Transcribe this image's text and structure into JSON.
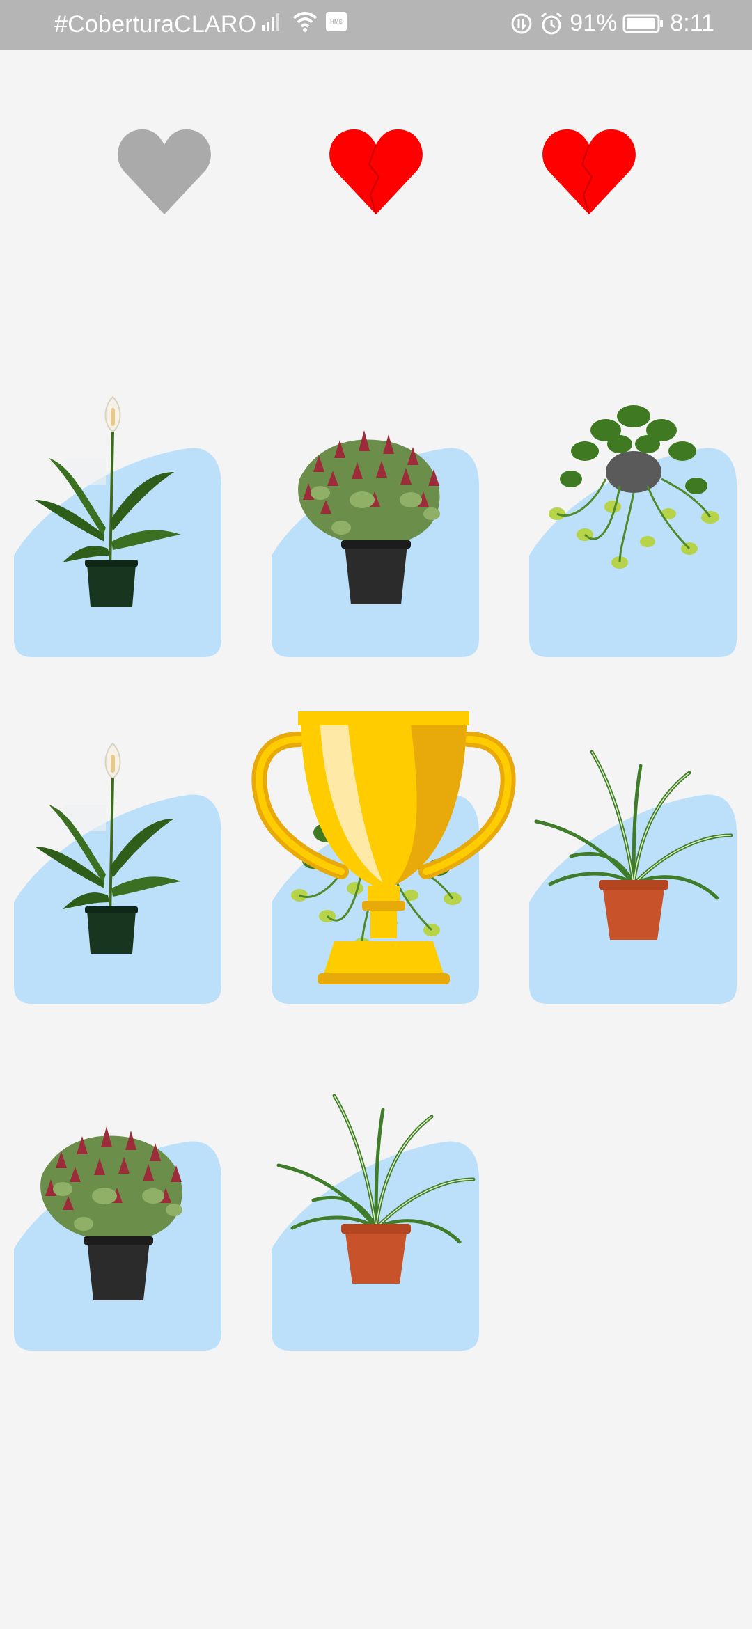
{
  "status_bar": {
    "carrier": "#CoberturaCLARO",
    "hms_badge": "HMS",
    "battery": "91%",
    "time": "8:11",
    "icons": [
      "signal-icon",
      "wifi-icon",
      "hms-icon",
      "data-saver-icon",
      "alarm-icon",
      "battery-icon"
    ]
  },
  "lives": {
    "hearts": [
      "heart-grey",
      "heart-broken-red",
      "heart-broken-red"
    ],
    "colors": {
      "lost": "#aaaaaa",
      "active": "#ff0000"
    }
  },
  "colors": {
    "card_bg": "#bde0fa",
    "page_bg": "#f4f4f4",
    "trophy": "#ffcc00"
  },
  "cards": [
    {
      "plant": "peace-lily"
    },
    {
      "plant": "cactus-red"
    },
    {
      "plant": "pothos-hanging"
    },
    {
      "plant": "peace-lily"
    },
    {
      "plant": "pothos-hanging",
      "overlay": "trophy"
    },
    {
      "plant": "spider-plant"
    },
    {
      "plant": "cactus-red"
    },
    {
      "plant": "spider-plant"
    }
  ]
}
